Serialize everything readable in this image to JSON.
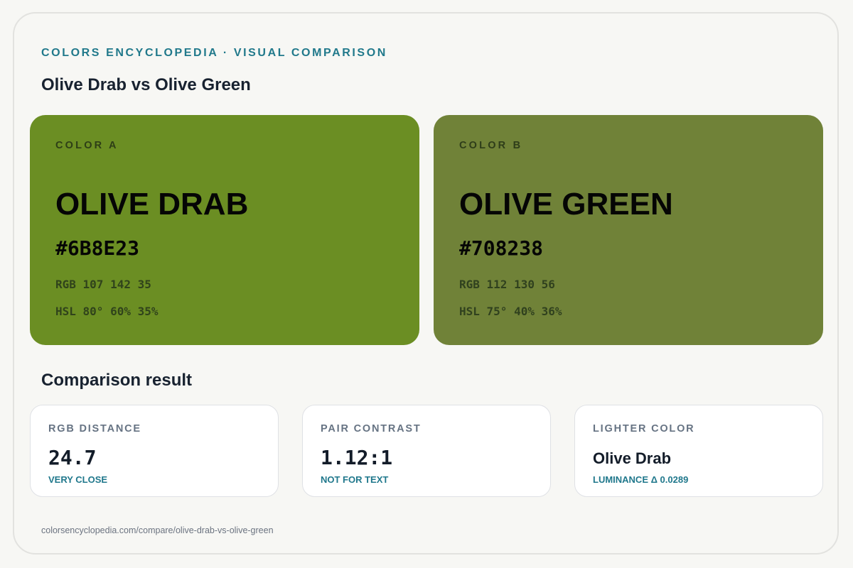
{
  "header": {
    "eyebrow": "COLORS ENCYCLOPEDIA · VISUAL COMPARISON",
    "title": "Olive Drab vs Olive Green"
  },
  "colors": [
    {
      "label": "COLOR A",
      "name": "OLIVE DRAB",
      "hex": "#6B8E23",
      "rgb": "RGB 107 142 35",
      "hsl": "HSL 80° 60% 35%",
      "swatch_color": "#6B8E23"
    },
    {
      "label": "COLOR B",
      "name": "OLIVE GREEN",
      "hex": "#708238",
      "rgb": "RGB 112 130 56",
      "hsl": "HSL 75° 40% 36%",
      "swatch_color": "#708238"
    }
  ],
  "comparison": {
    "title": "Comparison result",
    "metrics": [
      {
        "label": "RGB DISTANCE",
        "value": "24.7",
        "note": "VERY CLOSE"
      },
      {
        "label": "PAIR CONTRAST",
        "value": "1.12:1",
        "note": "NOT FOR TEXT"
      },
      {
        "label": "LIGHTER COLOR",
        "value": "Olive Drab",
        "note": "LUMINANCE Δ 0.0289"
      }
    ]
  },
  "footer": {
    "url": "colorsencyclopedia.com/compare/olive-drab-vs-olive-green"
  },
  "theme": {
    "accent": "#21798B",
    "page_background": "#F7F7F4",
    "card_border": "#E2E2DF"
  }
}
